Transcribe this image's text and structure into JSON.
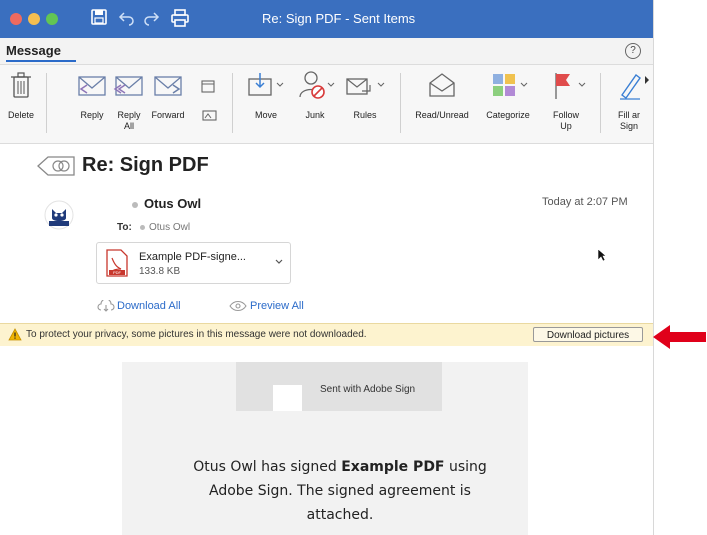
{
  "window": {
    "title": "Re: Sign PDF - Sent Items"
  },
  "tabs": {
    "active": "Message",
    "help": "?"
  },
  "ribbon": {
    "delete": "Delete",
    "reply": "Reply",
    "reply_all_1": "Reply",
    "reply_all_2": "All",
    "forward": "Forward",
    "move": "Move",
    "junk": "Junk",
    "rules": "Rules",
    "read_unread": "Read/Unread",
    "categorize": "Categorize",
    "follow_up_1": "Follow",
    "follow_up_2": "Up",
    "fill_1": "Fill ar",
    "fill_2": "Sign"
  },
  "message": {
    "subject": "Re: Sign PDF",
    "sender": "Otus Owl",
    "time": "Today at 2:07 PM",
    "to_label": "To:",
    "to_value": "Otus Owl",
    "attachment": {
      "name": "Example PDF-signe...",
      "size": "133.8 KB",
      "type": "PDF"
    },
    "download_all": "Download All",
    "preview_all": "Preview All"
  },
  "privacy": {
    "text": "To protect your privacy, some pictures in this message were not downloaded.",
    "button": "Download pictures"
  },
  "body": {
    "banner": "Sent with Adobe Sign",
    "text_pre": "Otus Owl has signed ",
    "text_bold": "Example PDF",
    "text_post": " using Adobe Sign. The signed agreement is attached."
  },
  "colors": {
    "titlebar": "#3a6fbf",
    "link": "#2b6bc9",
    "warning_bg": "#fdf3cf",
    "arrow": "#e0001a"
  },
  "icons": [
    "save-icon",
    "undo-icon",
    "redo-icon",
    "print-icon",
    "help-icon",
    "trash-icon",
    "reply-icon",
    "reply-all-icon",
    "forward-icon",
    "more-respond-icon",
    "move-icon",
    "junk-icon",
    "rules-icon",
    "envelope-open-icon",
    "categorize-icon",
    "flag-icon",
    "pen-icon",
    "back-arrow-icon",
    "avatar",
    "pdf-icon",
    "cloud-download-icon",
    "eye-icon",
    "warning-icon",
    "red-arrow-icon"
  ]
}
